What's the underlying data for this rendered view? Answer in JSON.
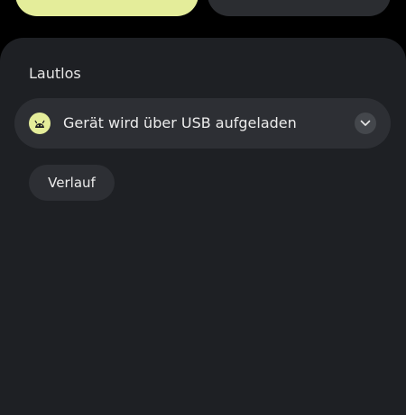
{
  "notification_shade": {
    "section_title": "Lautlos",
    "notification": {
      "text": "Gerät wird über USB aufgeladen",
      "icon": "android-icon",
      "expand_icon": "chevron-down-icon"
    },
    "history_label": "Verlauf"
  },
  "colors": {
    "accent": "#e4ed9a",
    "panel": "#1e2024",
    "card": "#2d2f34"
  }
}
